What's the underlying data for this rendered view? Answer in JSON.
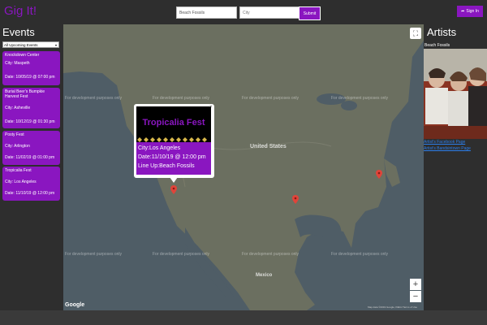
{
  "header": {
    "logo": "Gig It!",
    "artist_search_value": "Beach Fossils",
    "city_search_placeholder": "City",
    "submit_label": "Submit",
    "signin_label": "Sign In"
  },
  "events": {
    "title": "Events",
    "filter_selected": "All Upcoming Events",
    "items": [
      {
        "name": "Knockdown Center",
        "city": "City: Maspeth",
        "date": "Date: 10/05/19 @ 07:00 pm"
      },
      {
        "name": "Burial Beer's Bumpkie Harvest Fest",
        "city": "City: Asheville",
        "date": "Date: 10/12/19 @ 01:30 pm"
      },
      {
        "name": "Posty Fest",
        "city": "City: Arlington",
        "date": "Date: 11/02/19 @ 01:00 pm"
      },
      {
        "name": "Tropicalia Fest",
        "city": "City: Los Angeles",
        "date": "Date: 11/10/19 @ 12:00 pm"
      }
    ]
  },
  "map": {
    "watermark": "For development purposes only",
    "country_label": "United States",
    "mexico_label": "Mexico",
    "google_label": "Google",
    "terms_text": "Map data ©2019 Google, INEGI   Terms of Use",
    "zoom_in": "+",
    "zoom_out": "−",
    "fullscreen_icon": "⛶"
  },
  "info_window": {
    "title": "Tropicalia Fest",
    "city": "City:Los Angeles",
    "date": "Date:11/10/19 @ 12:00 pm",
    "lineup": "Line Up:Beach Fossils",
    "close": "×"
  },
  "artists": {
    "title": "Artists",
    "name": "Beach Fossils",
    "links": [
      "Artist's Facebook Page",
      "Artist's Bandsintown Page"
    ]
  },
  "colors": {
    "accent": "#8a16c0",
    "panel": "#2e2e2e",
    "map_land": "#6b6f60",
    "map_water": "#4f5d66"
  }
}
